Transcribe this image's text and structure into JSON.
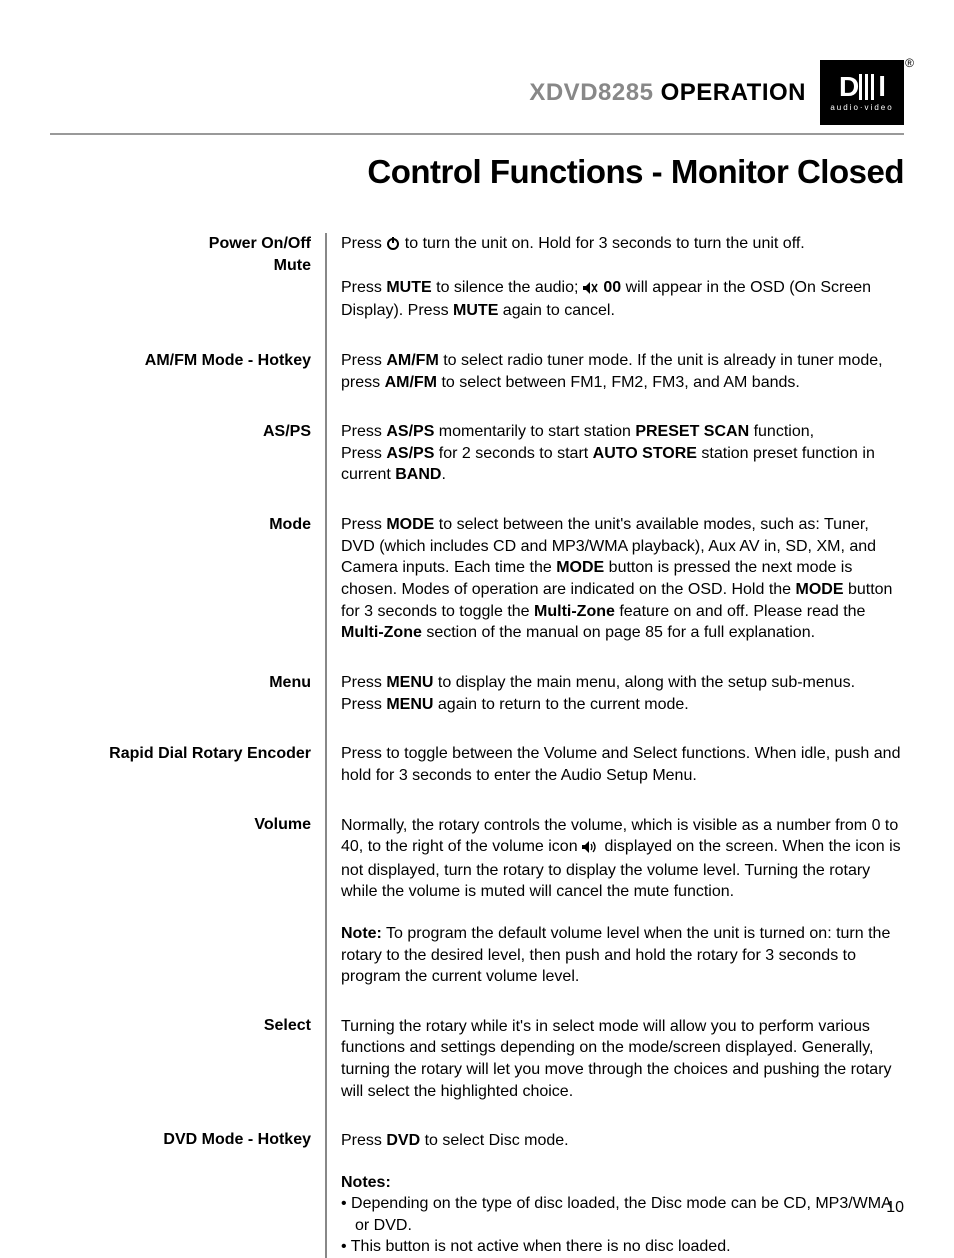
{
  "header": {
    "model": "XDVD8285",
    "section": "OPERATION",
    "brand_top": "DUAL",
    "brand_sub": "audio·video"
  },
  "page_title": "Control Functions - Monitor Closed",
  "page_number": "10",
  "rows": [
    {
      "label_line1": "Power On/Off",
      "label_line2": "Mute",
      "paras": [
        {
          "html": "Press <span class='power-icon' data-name='power-icon' data-interactable='false'><svg width='14' height='14' viewBox='0 0 14 14'><circle cx='7' cy='8' r='5' fill='none' stroke='#000' stroke-width='2'/><line x1='7' y1='1' x2='7' y2='7' stroke='#000' stroke-width='2'/></svg></span> to turn the unit on. Hold for 3 seconds to turn the unit off."
        },
        {
          "html": "Press <b>MUTE</b> to silence the audio; <span class='mute-icon' data-name='mute-icon' data-interactable='false'><svg width='16' height='12' viewBox='0 0 16 12'><polygon points='0,4 3,4 7,0 7,12 3,8 0,8' fill='#000'/><line x1='9' y1='2' x2='14' y2='10' stroke='#000' stroke-width='1.5'/><line x1='14' y1='2' x2='9' y2='10' stroke='#000' stroke-width='1.5'/></svg></span> <b>00</b> will appear in the OSD (On Screen Display). Press <b>MUTE</b> again to cancel."
        }
      ]
    },
    {
      "label_line1": "AM/FM Mode - Hotkey",
      "paras": [
        {
          "html": "Press <b>AM/FM</b> to select radio tuner mode. If the unit is already in tuner mode, press <b>AM/FM</b> to select between FM1, FM2, FM3, and AM bands."
        }
      ]
    },
    {
      "label_line1": "AS/PS",
      "paras": [
        {
          "html": "Press <b>AS/PS</b> momentarily to start station <b>PRESET SCAN</b> function,"
        },
        {
          "html": "Press <b>AS/PS</b> for 2 seconds to start <b>AUTO STORE</b> station preset function in current <b>BAND</b>."
        }
      ],
      "tight": true
    },
    {
      "label_line1": "Mode",
      "paras": [
        {
          "html": "Press <b>MODE</b> to select between the unit's available modes, such as: Tuner, DVD (which includes CD and MP3/WMA playback), Aux AV in, SD, XM, and Camera inputs. Each time the <b>MODE</b> button is pressed the next mode is chosen.  Modes of operation are indicated on the OSD. Hold the <b>MODE</b> button for 3 seconds to toggle the <b>Multi-Zone</b> feature on and off. Please read the <b>Multi-Zone</b> section of the manual on page 85 for a full explanation."
        }
      ]
    },
    {
      "label_line1": "Menu",
      "paras": [
        {
          "html": "Press <b>MENU</b> to display the main menu, along with the setup sub-menus."
        },
        {
          "html": "Press <b>MENU</b> again to return to the current mode."
        }
      ],
      "tight": true
    },
    {
      "label_line1": "Rapid Dial Rotary Encoder",
      "paras": [
        {
          "html": "Press to toggle between the Volume and Select functions. When idle, push and hold for 3 seconds to enter the Audio Setup Menu."
        }
      ]
    },
    {
      "label_line1": "Volume",
      "paras": [
        {
          "html": "Normally, the rotary controls the volume, which is visible as a number from 0 to 40, to the right of the volume icon <span class='vol-icon' data-name='volume-icon' data-interactable='false'><svg width='18' height='12' viewBox='0 0 18 12'><polygon points='0,4 3,4 7,0 7,12 3,8 0,8' fill='#000'/><path d='M9,3 Q11,6 9,9' fill='none' stroke='#000' stroke-width='1.3'/><path d='M11,1 Q15,6 11,11' fill='none' stroke='#000' stroke-width='1.3'/></svg></span> displayed on the screen. When the icon is not displayed, turn the rotary to display the volume level. Turning the rotary while the volume is muted will cancel the mute function."
        },
        {
          "html": "<b>Note:</b> To program the default volume level when the unit is turned on: turn the rotary to the desired level, then push and hold the rotary for 3 seconds to program the current volume level."
        }
      ]
    },
    {
      "label_line1": "Select",
      "paras": [
        {
          "html": "Turning the rotary while it's in select mode will allow you to perform various functions and settings depending on the mode/screen displayed. Generally, turning the rotary will let you move through the choices and pushing the rotary will select the highlighted choice."
        }
      ]
    },
    {
      "label_line1": "DVD Mode - Hotkey",
      "paras": [
        {
          "html": "Press <b>DVD</b> to select Disc mode."
        },
        {
          "html": "<b>Notes:</b><ul class='notes'><li><span class='wrap'>Depending on the type of disc loaded, the Disc mode can be CD, MP3/WMA or DVD.</span></li><li><span class='wrap'>This button is not active when there is no disc loaded.</span></li></ul>"
        }
      ]
    }
  ]
}
